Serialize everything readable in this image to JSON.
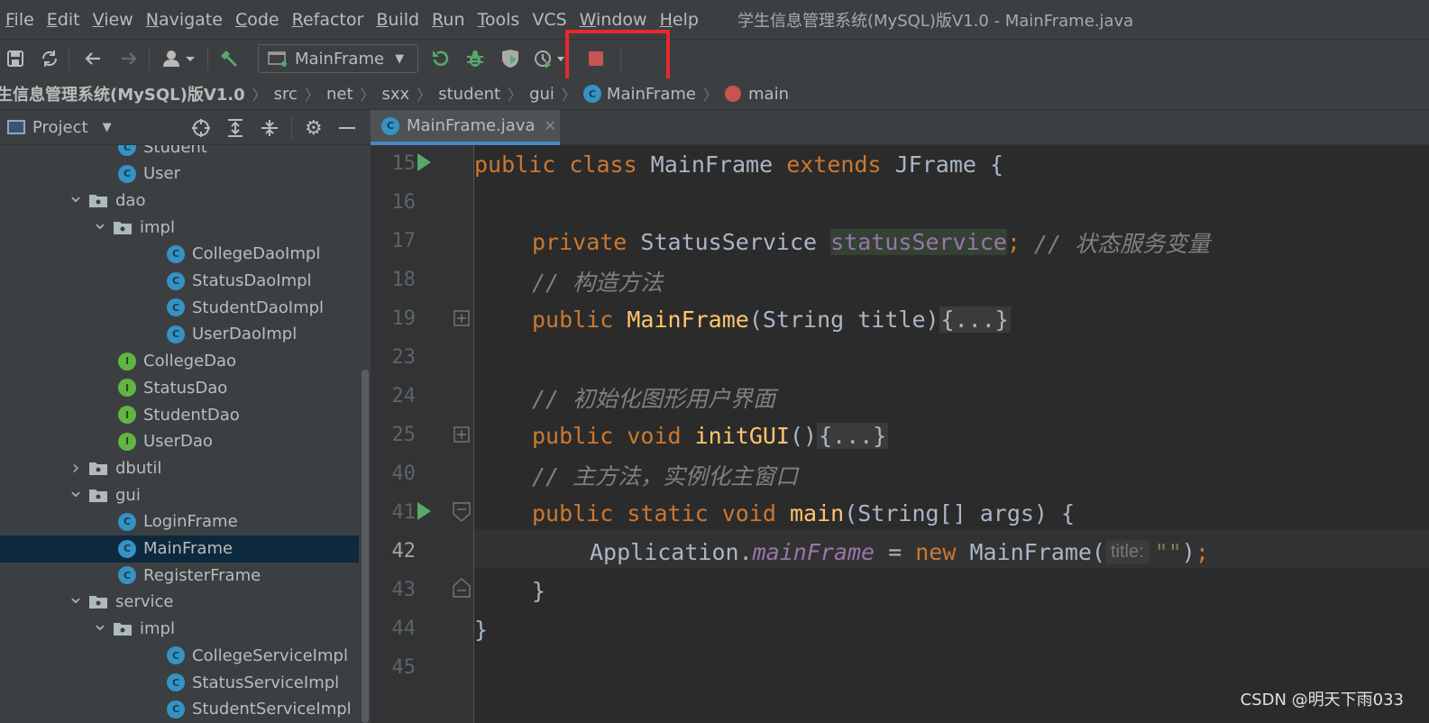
{
  "menu": {
    "items": [
      {
        "m": "F",
        "rest": "ile"
      },
      {
        "m": "E",
        "rest": "dit"
      },
      {
        "m": "V",
        "rest": "iew"
      },
      {
        "m": "N",
        "rest": "avigate"
      },
      {
        "m": "C",
        "rest": "ode"
      },
      {
        "m": "R",
        "rest": "efactor"
      },
      {
        "m": "B",
        "rest": "uild"
      },
      {
        "m": "R",
        "rest": "un"
      },
      {
        "m": "T",
        "rest": "ools"
      },
      {
        "m": "",
        "rest": "VCS"
      },
      {
        "m": "W",
        "rest": "indow"
      },
      {
        "m": "H",
        "rest": "elp"
      }
    ],
    "window_title": "学生信息管理系统(MySQL)版V1.0 - MainFrame.java"
  },
  "toolbar": {
    "run_config": "MainFrame",
    "icons": [
      "save-icon",
      "sync-icon",
      "back-icon",
      "forward-icon",
      "user-icon",
      "build-hammer-icon",
      "rerun-icon",
      "debug-icon",
      "coverage-icon",
      "profile-icon",
      "stop-icon"
    ],
    "stop_color": "#c75450"
  },
  "breadcrumb": {
    "items": [
      "生信息管理系统(MySQL)版V1.0",
      "src",
      "net",
      "sxx",
      "student",
      "gui",
      "MainFrame",
      "main"
    ]
  },
  "project": {
    "title": "Project",
    "tree": [
      {
        "label": "Student",
        "type": "class",
        "depth": 2
      },
      {
        "label": "User",
        "type": "class",
        "depth": 2
      },
      {
        "label": "dao",
        "type": "folder",
        "depth": 1,
        "expanded": true
      },
      {
        "label": "impl",
        "type": "folder",
        "depth": 2,
        "expanded": true
      },
      {
        "label": "CollegeDaoImpl",
        "type": "class",
        "depth": 3
      },
      {
        "label": "StatusDaoImpl",
        "type": "class",
        "depth": 3
      },
      {
        "label": "StudentDaoImpl",
        "type": "class",
        "depth": 3
      },
      {
        "label": "UserDaoImpl",
        "type": "class",
        "depth": 3
      },
      {
        "label": "CollegeDao",
        "type": "interface",
        "depth": 2
      },
      {
        "label": "StatusDao",
        "type": "interface",
        "depth": 2
      },
      {
        "label": "StudentDao",
        "type": "interface",
        "depth": 2
      },
      {
        "label": "UserDao",
        "type": "interface",
        "depth": 2
      },
      {
        "label": "dbutil",
        "type": "folder",
        "depth": 1,
        "expanded": false
      },
      {
        "label": "gui",
        "type": "folder",
        "depth": 1,
        "expanded": true
      },
      {
        "label": "LoginFrame",
        "type": "class",
        "depth": 2
      },
      {
        "label": "MainFrame",
        "type": "class",
        "depth": 2,
        "selected": true
      },
      {
        "label": "RegisterFrame",
        "type": "class",
        "depth": 2
      },
      {
        "label": "service",
        "type": "folder",
        "depth": 1,
        "expanded": true
      },
      {
        "label": "impl",
        "type": "folder",
        "depth": 2,
        "expanded": true
      },
      {
        "label": "CollegeServiceImpl",
        "type": "class",
        "depth": 3
      },
      {
        "label": "StatusServiceImpl",
        "type": "class",
        "depth": 3
      },
      {
        "label": "StudentServiceImpl",
        "type": "class",
        "depth": 3
      }
    ]
  },
  "editor": {
    "tab": "MainFrame.java",
    "line_numbers": [
      "15",
      "16",
      "17",
      "18",
      "19",
      "23",
      "24",
      "25",
      "40",
      "41",
      "42",
      "43",
      "44",
      "45"
    ],
    "code": {
      "l15": {
        "kw1": "public class ",
        "name": "MainFrame ",
        "kw2": "extends ",
        "rest": "JFrame {"
      },
      "l17": {
        "kw": "private ",
        "type": "StatusService ",
        "field": "statusService",
        "semi": ";",
        "comment": " // 状态服务变量"
      },
      "l18": {
        "comment": "// 构造方法"
      },
      "l19": {
        "kw": "public ",
        "fn": "MainFrame",
        "args": "(String title)",
        "fold": "{...}"
      },
      "l24": {
        "comment": "// 初始化图形用户界面"
      },
      "l25": {
        "kw": "public void ",
        "fn": "initGUI",
        "args": "()",
        "fold": "{...}"
      },
      "l40": {
        "comment": "// 主方法，实例化主窗口"
      },
      "l41": {
        "kw": "public static void ",
        "fn": "main",
        "args": "(String[] args) {"
      },
      "l42": {
        "obj": "Application.",
        "field": "mainFrame",
        "eq": " = ",
        "kw": "new ",
        "cls": "MainFrame(",
        "hint": "title:",
        "str": "\"\"",
        "end": ")",
        "semi": ";"
      },
      "l43": {
        "text": "}"
      },
      "l44": {
        "text": "}"
      }
    }
  },
  "watermark": "CSDN @明天下雨033"
}
